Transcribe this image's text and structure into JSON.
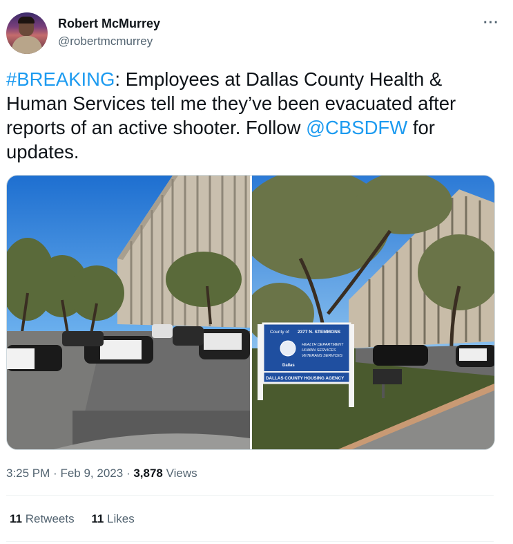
{
  "author": {
    "name": "Robert McMurrey",
    "handle": "@robertmcmurrey"
  },
  "more_label": "···",
  "tweet": {
    "parts": [
      {
        "text": "#BREAKING",
        "type": "link"
      },
      {
        "text": ": Employees at Dallas County Health & Human Services tell me they’ve been evacuated after reports of an active shooter. Follow ",
        "type": "text"
      },
      {
        "text": "@CBSDFW",
        "type": "link"
      },
      {
        "text": " for updates.",
        "type": "text"
      }
    ]
  },
  "media": {
    "right_photo_sign": {
      "line1_left": "County of",
      "line1_right": "2377 N. STEMMONS",
      "line2": "HEALTH DEPARTMENT",
      "line3": "HUMAN SERVICES",
      "line4": "VETERANS SERVICES",
      "city": "Dallas",
      "bottom": "DALLAS COUNTY HOUSING AGENCY"
    },
    "colors": {
      "link": "#1d9bf0",
      "sky": "#2a7fd8",
      "sign": "#1f4fa0"
    }
  },
  "meta": {
    "time": "3:25 PM",
    "sep1": "·",
    "date": "Feb 9, 2023",
    "sep2": "·",
    "views_count": "3,878",
    "views_label": "Views"
  },
  "stats": {
    "retweets_count": "11",
    "retweets_label": "Retweets",
    "likes_count": "11",
    "likes_label": "Likes"
  }
}
